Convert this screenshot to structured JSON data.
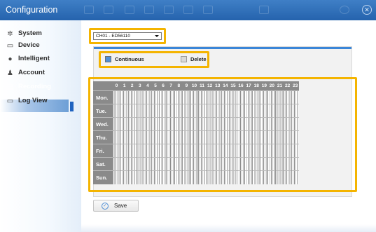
{
  "header": {
    "title": "Configuration"
  },
  "sidebar": {
    "items": [
      {
        "label": "System",
        "icon": "gear-icon"
      },
      {
        "label": "Device",
        "icon": "device-icon"
      },
      {
        "label": "Intelligent",
        "icon": "bulb-icon"
      },
      {
        "label": "Account",
        "icon": "user-icon"
      },
      {
        "label": "Recording",
        "icon": "recording-icon",
        "active": true
      },
      {
        "label": "Log View",
        "icon": "monitor-icon"
      }
    ]
  },
  "channel": {
    "selected": "CH01 - ED56110"
  },
  "legend": {
    "continuous_label": "Continuous",
    "delete_label": "Delete",
    "continuous_color": "#4f8fd6",
    "delete_color": "#d9d9d9"
  },
  "schedule": {
    "hours": [
      "0",
      "1",
      "2",
      "3",
      "4",
      "5",
      "6",
      "7",
      "8",
      "9",
      "10",
      "11",
      "12",
      "13",
      "14",
      "15",
      "16",
      "17",
      "18",
      "19",
      "20",
      "21",
      "22",
      "23"
    ],
    "days": [
      "Mon.",
      "Tue.",
      "Wed.",
      "Thu.",
      "Fri.",
      "Sat.",
      "Sun."
    ]
  },
  "actions": {
    "save_label": "Save"
  },
  "colors": {
    "accent": "#2b6cb8",
    "highlight": "#f4b400",
    "active_marker": "#1f63c0"
  }
}
